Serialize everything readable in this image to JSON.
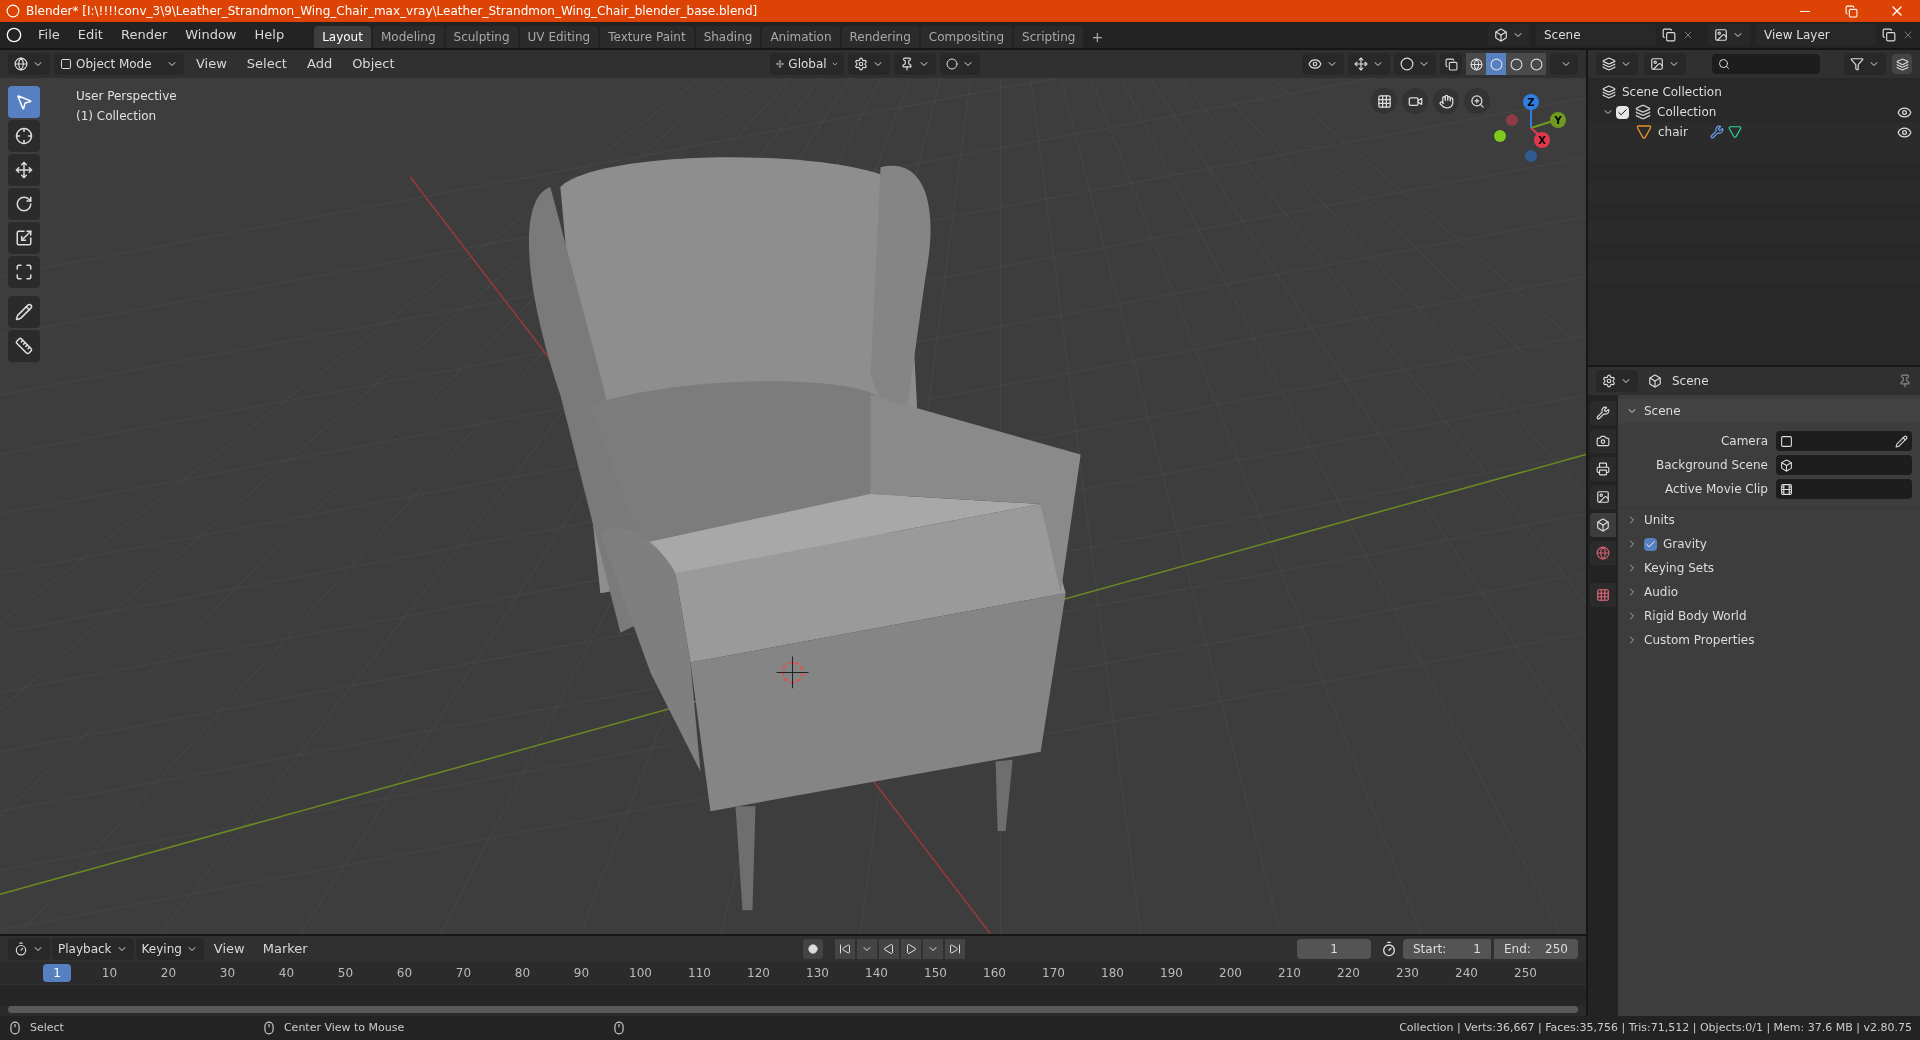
{
  "window": {
    "title": "Blender* [I:\\!!!!conv_3\\9\\Leather_Strandmon_Wing_Chair_max_vray\\Leather_Strandmon_Wing_Chair_blender_base.blend]"
  },
  "menu": [
    "File",
    "Edit",
    "Render",
    "Window",
    "Help"
  ],
  "workspaces": [
    {
      "label": "Layout",
      "selected": true
    },
    {
      "label": "Modeling",
      "selected": false
    },
    {
      "label": "Sculpting",
      "selected": false
    },
    {
      "label": "UV Editing",
      "selected": false
    },
    {
      "label": "Texture Paint",
      "selected": false
    },
    {
      "label": "Shading",
      "selected": false
    },
    {
      "label": "Animation",
      "selected": false
    },
    {
      "label": "Rendering",
      "selected": false
    },
    {
      "label": "Compositing",
      "selected": false
    },
    {
      "label": "Scripting",
      "selected": false
    }
  ],
  "add_workspace": "+",
  "scene": "Scene",
  "view_layer": "View Layer",
  "viewport": {
    "mode": "Object Mode",
    "menus": [
      "View",
      "Select",
      "Add",
      "Object"
    ],
    "orientation": "Global",
    "overlay_lines": [
      "User Perspective",
      "(1) Collection"
    ],
    "tools": [
      {
        "kind": "select",
        "selected": true
      },
      {
        "kind": "cursor",
        "selected": false
      },
      {
        "kind": "move",
        "selected": false
      },
      {
        "kind": "rotate",
        "selected": false
      },
      {
        "kind": "scale",
        "selected": false
      },
      {
        "kind": "transform",
        "selected": false
      },
      {
        "kind": "annotate",
        "selected": false
      },
      {
        "kind": "measure",
        "selected": false
      }
    ],
    "gizmo": {
      "z": "Z",
      "y": "Y",
      "x": "X"
    }
  },
  "outliner": {
    "root": "Scene Collection",
    "children": [
      {
        "label": "Collection",
        "checked": true,
        "visible": true,
        "expanded": true,
        "children": [
          {
            "label": "chair",
            "visible": true
          }
        ]
      }
    ]
  },
  "properties": {
    "context": "Scene",
    "tabs": [
      {
        "kind": "tool",
        "selected": false
      },
      {
        "kind": "render",
        "selected": false
      },
      {
        "kind": "output",
        "selected": false
      },
      {
        "kind": "view_layer",
        "selected": false
      },
      {
        "kind": "scene",
        "selected": true
      },
      {
        "kind": "world",
        "selected": false
      },
      {
        "kind": "texture",
        "selected": false
      }
    ],
    "panel": {
      "title": "Scene",
      "expanded": true,
      "fields": [
        {
          "label": "Camera",
          "kind": "camera"
        },
        {
          "label": "Background Scene",
          "kind": "scene"
        },
        {
          "label": "Active Movie Clip",
          "kind": "clip"
        }
      ]
    },
    "subpanels": [
      {
        "label": "Units"
      },
      {
        "label": "Gravity",
        "checked": true
      },
      {
        "label": "Keying Sets"
      },
      {
        "label": "Audio"
      },
      {
        "label": "Rigid Body World"
      },
      {
        "label": "Custom Properties"
      }
    ]
  },
  "timeline": {
    "menus": [
      "Playback",
      "Keying",
      "View",
      "Marker"
    ],
    "current_frame": "1",
    "start_label": "Start:",
    "start": "1",
    "end_label": "End:",
    "end": "250",
    "ruler": [
      {
        "label": "1",
        "selected": true
      },
      {
        "label": "10",
        "selected": false
      },
      {
        "label": "20",
        "selected": false
      },
      {
        "label": "30",
        "selected": false
      },
      {
        "label": "40",
        "selected": false
      },
      {
        "label": "50",
        "selected": false
      },
      {
        "label": "60",
        "selected": false
      },
      {
        "label": "70",
        "selected": false
      },
      {
        "label": "80",
        "selected": false
      },
      {
        "label": "90",
        "selected": false
      },
      {
        "label": "100",
        "selected": false
      },
      {
        "label": "110",
        "selected": false
      },
      {
        "label": "120",
        "selected": false
      },
      {
        "label": "130",
        "selected": false
      },
      {
        "label": "140",
        "selected": false
      },
      {
        "label": "150",
        "selected": false
      },
      {
        "label": "160",
        "selected": false
      },
      {
        "label": "170",
        "selected": false
      },
      {
        "label": "180",
        "selected": false
      },
      {
        "label": "190",
        "selected": false
      },
      {
        "label": "200",
        "selected": false
      },
      {
        "label": "210",
        "selected": false
      },
      {
        "label": "220",
        "selected": false
      },
      {
        "label": "230",
        "selected": false
      },
      {
        "label": "240",
        "selected": false
      },
      {
        "label": "250",
        "selected": false
      }
    ]
  },
  "status_bar": {
    "hints": [
      "Select",
      "Center View to Mouse"
    ],
    "stats": "Collection | Verts:36,667 | Faces:35,756 | Tris:71,512 | Objects:0/1 | Mem: 37.6 MB | v2.80.75"
  }
}
